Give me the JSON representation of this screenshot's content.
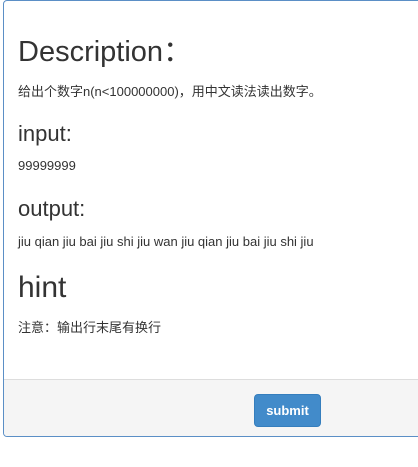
{
  "problem": {
    "description_title": "Description：",
    "description_text": "给出个数字n(n<100000000)，用中文读法读出数字。",
    "input_title": "input:",
    "input_text": "99999999",
    "output_title": "output:",
    "output_text": "jiu qian jiu bai jiu shi jiu wan jiu qian jiu bai jiu shi jiu",
    "hint_title": "hint",
    "hint_text": "注意：输出行末尾有换行"
  },
  "footer": {
    "submit_label": "submit"
  },
  "colors": {
    "panel_border": "#5b8fc6",
    "footer_bg": "#f5f5f5",
    "button_bg": "#428bca",
    "text": "#333333"
  }
}
